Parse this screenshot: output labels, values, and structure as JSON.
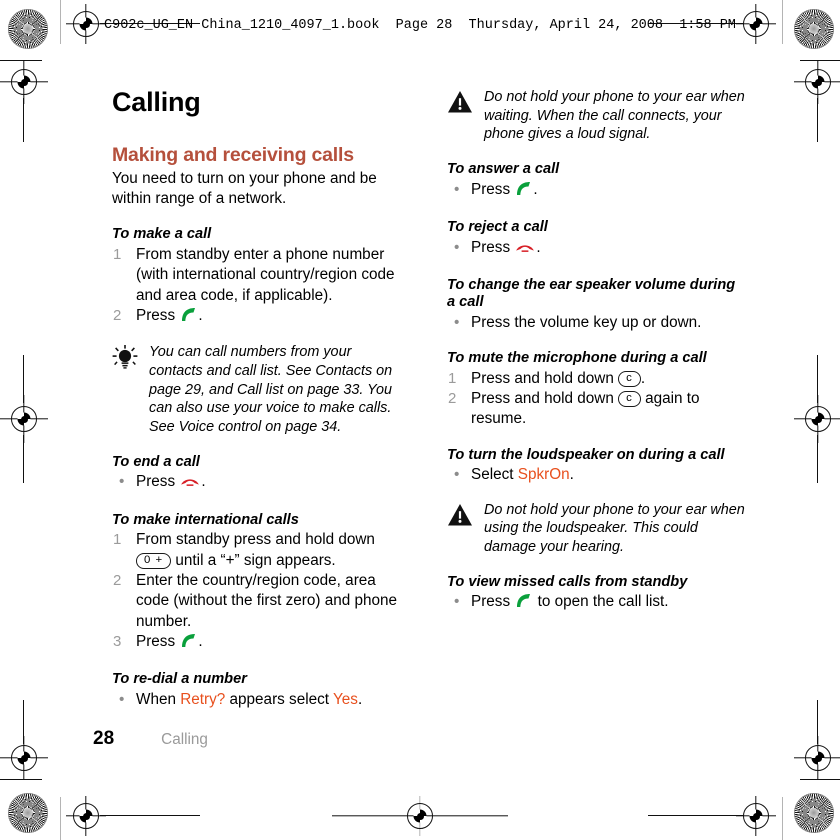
{
  "print_header": "C902c_UG_EN China_1210_4097_1.book  Page 28  Thursday, April 24, 2008  1:58 PM",
  "colors": {
    "section_heading": "#b5503c",
    "ui_term": "#e8501e",
    "step_number": "#9b9b9b",
    "footer_chapter": "#9a9a9a",
    "call_key": "#0aa03c",
    "end_call_key": "#d71f26"
  },
  "chapter_title": "Calling",
  "left_column": {
    "section_heading": "Making and receiving calls",
    "intro": "You need to turn on your phone and be within range of a network.",
    "blocks": [
      {
        "heading": "To make a call",
        "type": "ordered",
        "items": [
          "From standby enter a phone number (with international country/region code and area code, if applicable).",
          "Press "
        ]
      },
      {
        "type": "tip",
        "icon": "lightbulb-icon",
        "text": "You can call numbers from your contacts and call list. See Contacts on page 29, and Call list on page 33. You can also use your voice to make calls. See Voice control on page 34."
      },
      {
        "heading": "To end a call",
        "type": "bulleted",
        "items": [
          "Press "
        ]
      },
      {
        "heading": "To make international calls",
        "type": "ordered",
        "items": [
          "From standby press and hold down",
          "Enter the country/region code, area code (without the first zero) and phone number.",
          "Press "
        ],
        "step1_key": "0 +",
        "step1_tail": " until a “+” sign appears."
      },
      {
        "heading": "To re-dial a number",
        "type": "bulleted",
        "items": [
          "When ",
          "Retry?",
          " appears select ",
          "Yes",
          "."
        ]
      }
    ]
  },
  "right_column": {
    "blocks": [
      {
        "type": "warning",
        "icon": "warning-triangle-icon",
        "text": "Do not hold your phone to your ear when waiting. When the call connects, your phone gives a loud signal."
      },
      {
        "heading": "To answer a call",
        "type": "bulleted",
        "items": [
          "Press "
        ]
      },
      {
        "heading": "To reject a call",
        "type": "bulleted",
        "items": [
          "Press "
        ]
      },
      {
        "heading": "To change the ear speaker volume during a call",
        "type": "bulleted",
        "items": [
          "Press the volume key up or down."
        ]
      },
      {
        "heading": "To mute the microphone during a call",
        "type": "ordered",
        "items": [
          "Press and hold down",
          "Press and hold down"
        ],
        "key_label": "c",
        "step1_tail": ".",
        "step2_tail": " again to resume."
      },
      {
        "heading": "To turn the loudspeaker on during a call",
        "type": "bulleted",
        "items": [
          "Select ",
          "SpkrOn",
          "."
        ]
      },
      {
        "type": "warning",
        "icon": "warning-triangle-icon",
        "text": "Do not hold your phone to your ear when using the loudspeaker. This could damage your hearing."
      },
      {
        "heading": "To view missed calls from standby",
        "type": "bulleted",
        "items": [
          "Press ",
          " to open the call list."
        ]
      }
    ]
  },
  "footer": {
    "page_number": "28",
    "chapter": "Calling"
  },
  "labels": {
    "press": "Press ",
    "period": ".",
    "step_1": "1",
    "step_2": "2",
    "step_3": "3",
    "bullet": "•"
  }
}
